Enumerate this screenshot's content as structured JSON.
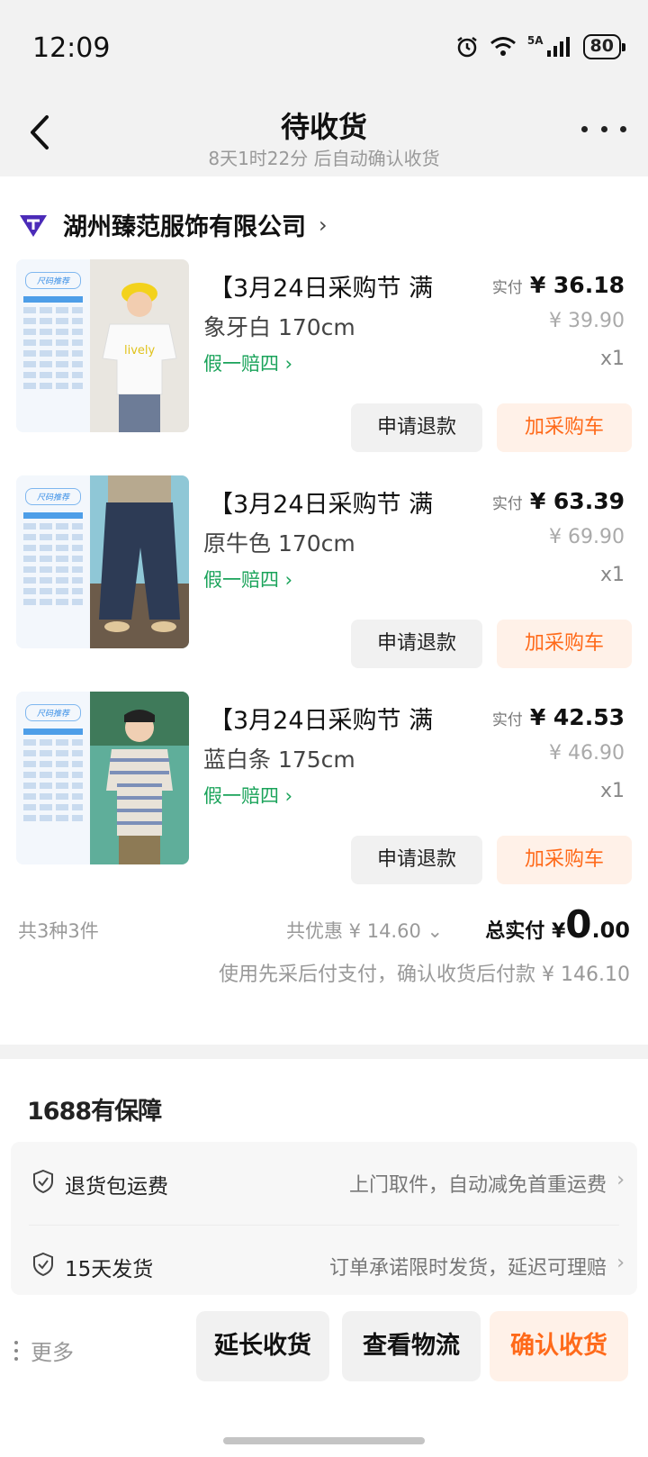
{
  "status_bar": {
    "time": "12:09",
    "network": "5A",
    "battery": "80"
  },
  "header": {
    "title": "待收货",
    "subtitle": "8天1时22分 后自动确认收货"
  },
  "shop": {
    "name": "湖州臻范服饰有限公司"
  },
  "items": [
    {
      "title": "【3月24日采购节 满",
      "spec": "象牙白 170cm",
      "guarantee": "假一赔四 ›",
      "paid_label": "实付",
      "paid": "¥ 36.18",
      "original": "¥ 39.90",
      "qty": "x1",
      "refund_label": "申请退款",
      "cart_label": "加采购车",
      "chart_title": "尺码推荐"
    },
    {
      "title": "【3月24日采购节 满",
      "spec": "原牛色 170cm",
      "guarantee": "假一赔四 ›",
      "paid_label": "实付",
      "paid": "¥ 63.39",
      "original": "¥ 69.90",
      "qty": "x1",
      "refund_label": "申请退款",
      "cart_label": "加采购车",
      "chart_title": "尺码推荐"
    },
    {
      "title": "【3月24日采购节 满",
      "spec": "蓝白条 175cm",
      "guarantee": "假一赔四 ›",
      "paid_label": "实付",
      "paid": "¥ 42.53",
      "original": "¥ 46.90",
      "qty": "x1",
      "refund_label": "申请退款",
      "cart_label": "加采购车",
      "chart_title": "尺码推荐"
    }
  ],
  "summary": {
    "count": "共3种3件",
    "discount": "共优惠 ¥ 14.60 ⌄",
    "total_label": "总实付",
    "total_currency": "¥",
    "total_int": "0",
    "total_dec": ".00",
    "pay_note": "使用先采后付支付，确认收货后付款 ¥ 146.10"
  },
  "guarantee_section": {
    "logo": "1688有保障",
    "rows": [
      {
        "name": "退货包运费",
        "desc": "上门取件，自动减免首重运费"
      },
      {
        "name": "15天发货",
        "desc": "订单承诺限时发货，延迟可理赔"
      }
    ]
  },
  "bottom": {
    "more": "更多",
    "extend": "延长收货",
    "logistics": "查看物流",
    "confirm": "确认收货"
  },
  "colors": {
    "accent": "#ff6a1a",
    "green": "#1aa35a",
    "accent_bg": "#fff1e8"
  }
}
